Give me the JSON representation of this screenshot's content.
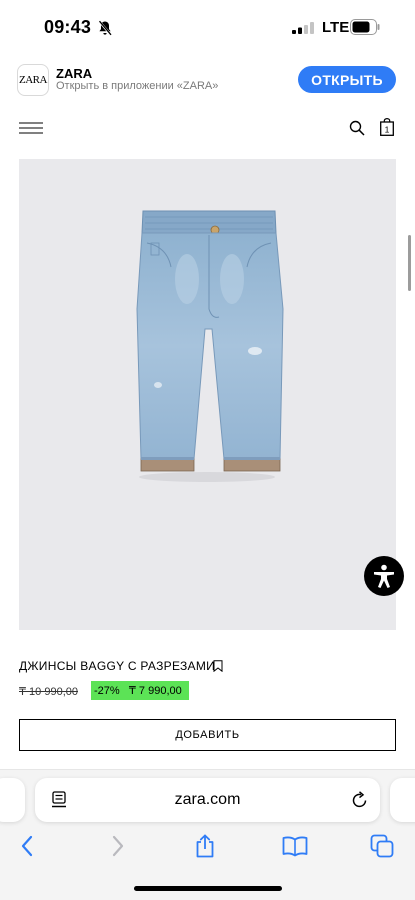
{
  "status_bar": {
    "time": "09:43",
    "network": "LTE",
    "icons": [
      "bell-muted-icon",
      "signal-icon",
      "battery-icon"
    ]
  },
  "app_banner": {
    "logo_text": "ZARA",
    "title": "ZARA",
    "subtitle": "Открыть в приложении «ZARA»",
    "open_label": "ОТКРЫТЬ",
    "accent_color": "#2f7cf6"
  },
  "header": {
    "icons": [
      "menu-icon",
      "search-icon",
      "shopping-bag-icon"
    ],
    "bag_count": "1"
  },
  "product": {
    "image_icon": "baggy-jeans-photo",
    "title": "ДЖИНСЫ BAGGY С РАЗРЕЗАМИ",
    "old_price": "₸ 10 990,00",
    "discount": "-27%",
    "new_price": "₸ 7 990,00",
    "sale_color": "#5ce356",
    "add_label": "ДОБАВИТЬ"
  },
  "browser": {
    "url": "zara.com",
    "nav_icons": [
      "back-icon",
      "forward-icon",
      "share-icon",
      "bookmarks-icon",
      "tabs-icon"
    ]
  }
}
